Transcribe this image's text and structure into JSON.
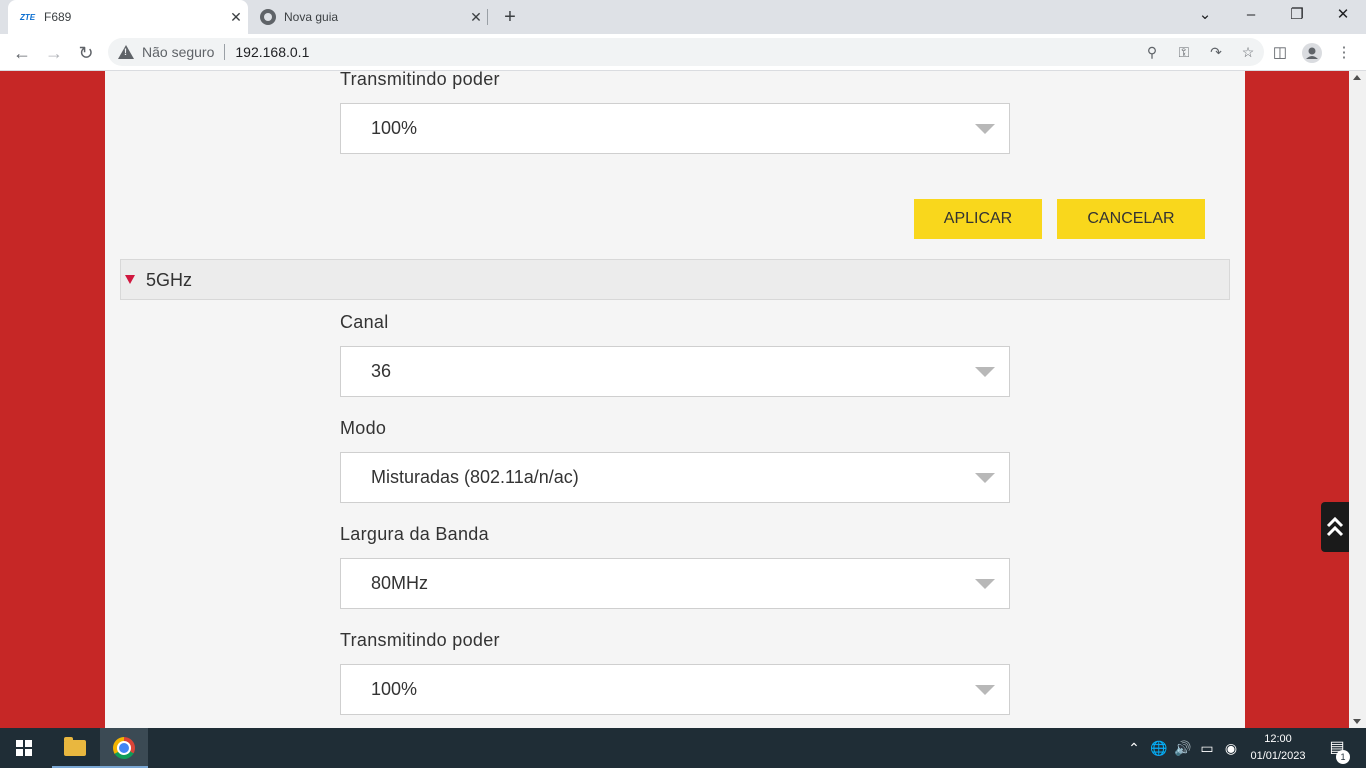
{
  "browser": {
    "tabs": [
      {
        "favicon": "ZTE",
        "title": "F689",
        "close": "✕"
      },
      {
        "title": "Nova guia",
        "close": "✕"
      }
    ],
    "new_tab": "+",
    "window_controls": {
      "dropdown": "⌄",
      "minimize": "–",
      "restore": "❐",
      "close": "✕"
    },
    "nav": {
      "back": "←",
      "forward": "→",
      "reload": "↻"
    },
    "security_label": "Não seguro",
    "url": "192.168.0.1",
    "omnibox_icons": [
      "search-icon",
      "key-icon",
      "share-icon",
      "star-icon"
    ],
    "toolbar_icons": [
      "side-panel-icon",
      "profile-icon",
      "menu-icon"
    ]
  },
  "page": {
    "top_field": {
      "label": "Transmitindo poder",
      "value": "100%"
    },
    "buttons": {
      "apply": "APLICAR",
      "cancel": "CANCELAR"
    },
    "section": {
      "title": "5GHz"
    },
    "fields": [
      {
        "label": "Canal",
        "value": "36"
      },
      {
        "label": "Modo",
        "value": "Misturadas (802.11a/n/ac)"
      },
      {
        "label": "Largura da Banda",
        "value": "80MHz"
      },
      {
        "label": "Transmitindo poder",
        "value": "100%"
      }
    ],
    "colors": {
      "background": "#c62726",
      "panel": "#f5f5f5",
      "button": "#f9d71c",
      "section_marker": "#d0173f"
    }
  },
  "taskbar": {
    "apps": [
      "windows-start-icon",
      "file-explorer-icon",
      "chrome-icon"
    ],
    "tray_icons": [
      "chevron-up-icon",
      "globe-icon",
      "volume-icon",
      "battery-icon",
      "camera-icon"
    ],
    "time": "12:00",
    "date": "01/01/2023",
    "notification_count": "1"
  }
}
